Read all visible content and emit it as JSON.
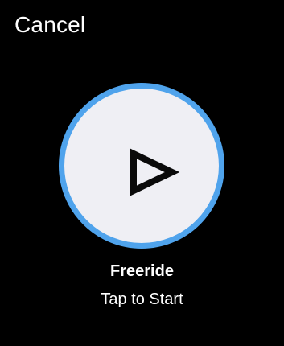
{
  "header": {
    "cancel_label": "Cancel"
  },
  "start": {
    "icon": "play-icon",
    "ring_color": "#4fa3ec",
    "fill_color": "#efeff4",
    "icon_color": "#0a0a0a"
  },
  "workout": {
    "title": "Freeride",
    "hint": "Tap to Start"
  }
}
